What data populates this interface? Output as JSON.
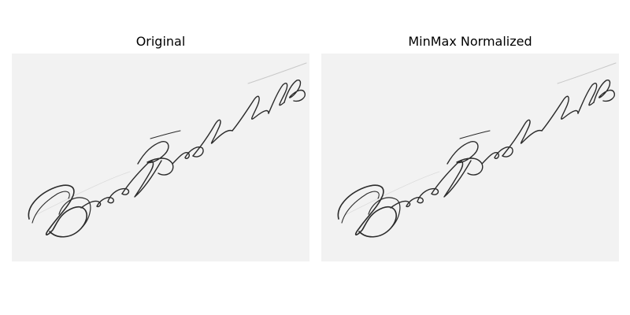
{
  "figure": {
    "panels": [
      {
        "title": "Original",
        "image": "handwritten-signature",
        "background": "#f2f2f2",
        "ink": "#2b2b2b"
      },
      {
        "title": "MinMax Normalized",
        "image": "handwritten-signature",
        "background": "#f2f2f2",
        "ink": "#2b2b2b"
      }
    ]
  }
}
